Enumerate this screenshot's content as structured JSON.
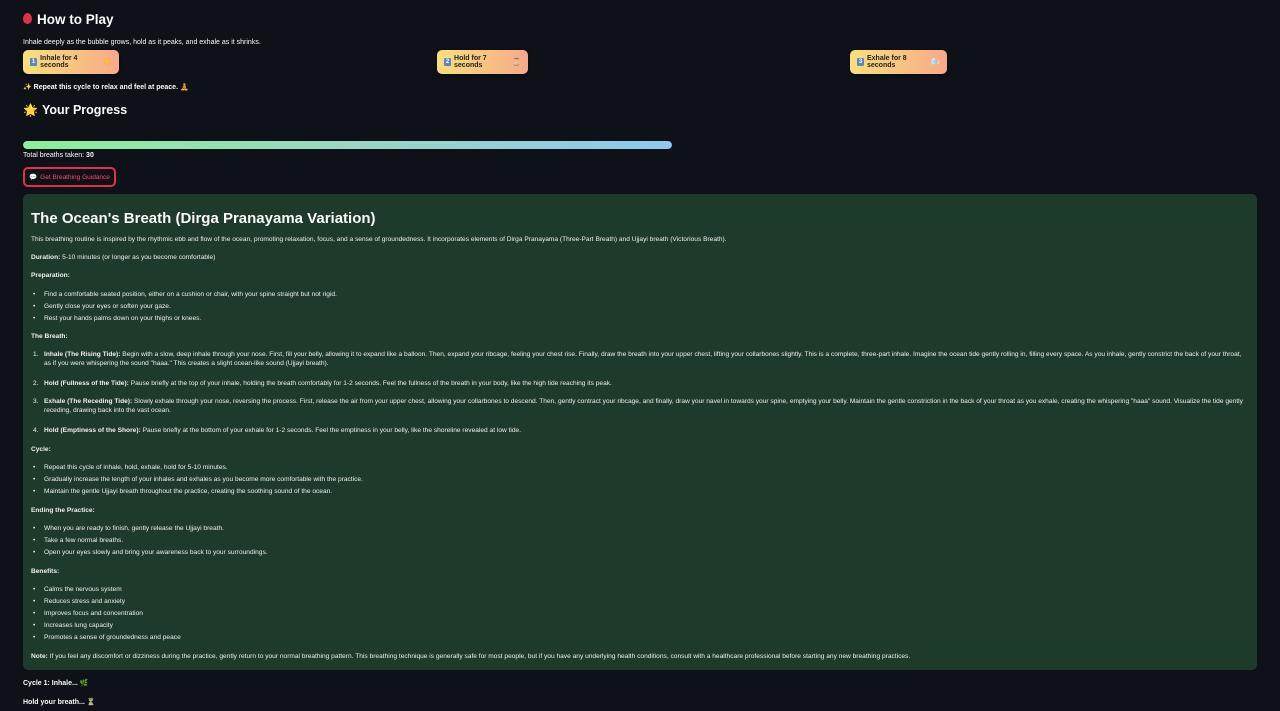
{
  "how": {
    "title": "How to Play",
    "intro": "Inhale deeply as the bubble grows, hold as it peaks, and exhale as it shrinks.",
    "steps": [
      {
        "num": "1",
        "label": "Inhale for 4 seconds",
        "emoji": "☀️"
      },
      {
        "num": "2",
        "label": "Hold for 7 seconds",
        "emoji": "⏳"
      },
      {
        "num": "3",
        "label": "Exhale for 8 seconds",
        "emoji": "🌬️"
      }
    ],
    "repeat_icon": "✨",
    "repeat": "Repeat this cycle to relax and feel at peace.",
    "repeat_emoji": "🧘"
  },
  "progress": {
    "icon": "🌟",
    "title": "Your Progress",
    "fraction": 1.0,
    "total_label": "Total breaths taken:",
    "total_value": "30"
  },
  "guidance_button": {
    "icon": "💬",
    "label": "Get Breathing Guidance"
  },
  "guidance": {
    "title": "The Ocean's Breath (Dirga Pranayama Variation)",
    "intro": "This breathing routine is inspired by the rhythmic ebb and flow of the ocean, promoting relaxation, focus, and a sense of groundedness. It incorporates elements of Dirga Pranayama (Three-Part Breath) and Ujjayi breath (Victorious Breath).",
    "duration_label": "Duration:",
    "duration": "5-10 minutes (or longer as you become comfortable)",
    "prep_heading": "Preparation:",
    "prep": [
      "Find a comfortable seated position, either on a cushion or chair, with your spine straight but not rigid.",
      "Gently close your eyes or soften your gaze.",
      "Rest your hands palms down on your thighs or knees."
    ],
    "breath_heading": "The Breath:",
    "breath": [
      {
        "num": "1.",
        "title": "Inhale (The Rising Tide):",
        "text": "Begin with a slow, deep inhale through your nose. First, fill your belly, allowing it to expand like a balloon. Then, expand your ribcage, feeling your chest rise. Finally, draw the breath into your upper chest, lifting your collarbones slightly. This is a complete, three-part inhale. Imagine the ocean tide gently rolling in, filling every space. As you inhale, gently constrict the back of your throat, as if you were whispering the sound \"haaa.\" This creates a slight ocean-like sound (Ujjayi breath)."
      },
      {
        "num": "2.",
        "title": "Hold (Fullness of the Tide):",
        "text": "Pause briefly at the top of your inhale, holding the breath comfortably for 1-2 seconds. Feel the fullness of the breath in your body, like the high tide reaching its peak."
      },
      {
        "num": "3.",
        "title": "Exhale (The Receding Tide):",
        "text": "Slowly exhale through your nose, reversing the process. First, release the air from your upper chest, allowing your collarbones to descend. Then, gently contract your ribcage, and finally, draw your navel in towards your spine, emptying your belly. Maintain the gentle constriction in the back of your throat as you exhale, creating the whispering \"haaa\" sound. Visualize the tide gently receding, drawing back into the vast ocean."
      },
      {
        "num": "4.",
        "title": "Hold (Emptiness of the Shore):",
        "text": "Pause briefly at the bottom of your exhale for 1-2 seconds. Feel the emptiness in your belly, like the shoreline revealed at low tide."
      }
    ],
    "cycle_heading": "Cycle:",
    "cycle": [
      "Repeat this cycle of inhale, hold, exhale, hold for 5-10 minutes.",
      "Gradually increase the length of your inhales and exhales as you become more comfortable with the practice.",
      "Maintain the gentle Ujjayi breath throughout the practice, creating the soothing sound of the ocean."
    ],
    "ending_heading": "Ending the Practice:",
    "ending": [
      "When you are ready to finish, gently release the Ujjayi breath.",
      "Take a few normal breaths.",
      "Open your eyes slowly and bring your awareness back to your surroundings."
    ],
    "benefits_heading": "Benefits:",
    "benefits": [
      "Calms the nervous system",
      "Reduces stress and anxiety",
      "Improves focus and concentration",
      "Increases lung capacity",
      "Promotes a sense of groundedness and peace"
    ],
    "note_label": "Note:",
    "note": "If you feel any discomfort or dizziness during the practice, gently return to your normal breathing pattern. This breathing technique is generally safe for most people, but if you have any underlying health conditions, consult with a healthcare professional before starting any new breathing practices."
  },
  "status": {
    "cycle": "Cycle 1: Inhale...",
    "cycle_emoji": "🌿",
    "hold": "Hold your breath...",
    "hold_emoji": "⏳"
  }
}
